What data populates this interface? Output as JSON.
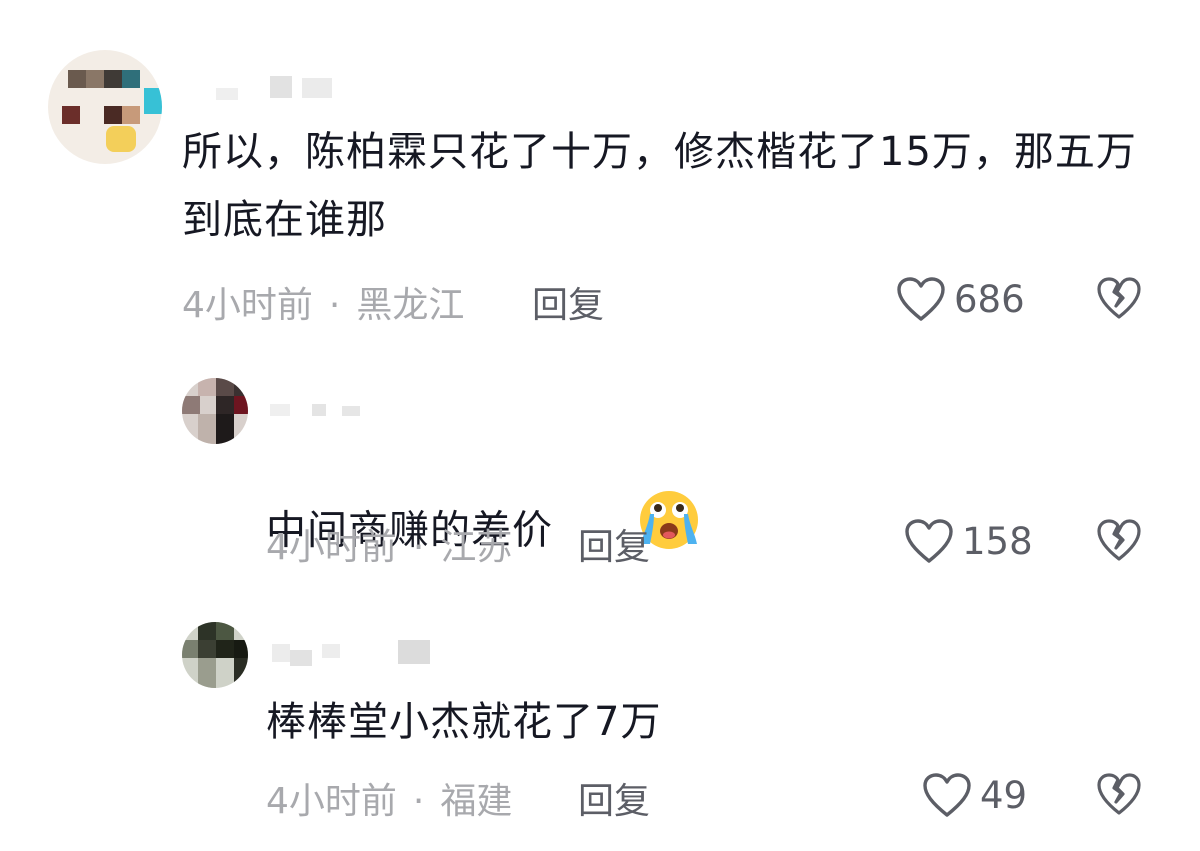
{
  "comments": [
    {
      "text": "所以，陈柏霖只花了十万，修杰楷花了15万，那五万到底在谁那",
      "time": "4小时前",
      "separator": "·",
      "location": "黑龙江",
      "reply_label": "回复",
      "likes": "686"
    },
    {
      "text": "中间商赚的差价",
      "emoji": "loudly-crying-face-emoji",
      "time": "4小时前",
      "separator": "·",
      "location": "江苏",
      "reply_label": "回复",
      "likes": "158"
    },
    {
      "text": "棒棒堂小杰就花了7万",
      "time": "4小时前",
      "separator": "·",
      "location": "福建",
      "reply_label": "回复",
      "likes": "49"
    }
  ],
  "icons": {
    "like": "heart-outline-icon",
    "dislike": "broken-heart-icon"
  },
  "colors": {
    "text": "#161823",
    "meta": "#a8a9ad",
    "secondary": "#5c5e66"
  }
}
